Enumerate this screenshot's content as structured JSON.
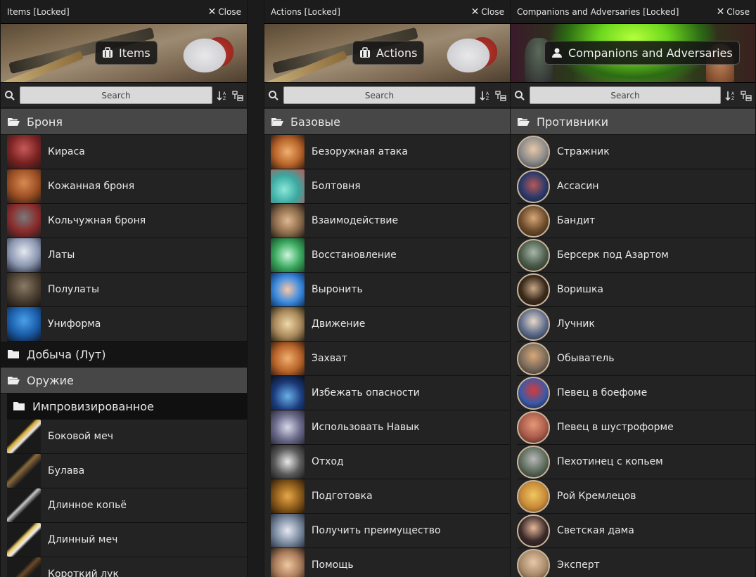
{
  "panels": {
    "items": {
      "title": "Items [Locked]",
      "close_label": "Close",
      "banner_label": "Items",
      "search_placeholder": "Search",
      "folders": [
        {
          "name": "Броня",
          "state": "open",
          "entries": [
            "Кираса",
            "Кожанная броня",
            "Кольчужная броня",
            "Латы",
            "Полулаты",
            "Униформа"
          ]
        },
        {
          "name": "Добыча (Лут)",
          "state": "closed",
          "entries": []
        },
        {
          "name": "Оружие",
          "state": "open",
          "entries": []
        }
      ],
      "subfolder": {
        "name": "Импровизированное",
        "state": "closed"
      },
      "weapon_entries": [
        "Боковой меч",
        "Булава",
        "Длинное копьё",
        "Длинный меч",
        "Короткий лук"
      ]
    },
    "actions": {
      "title": "Actions [Locked]",
      "close_label": "Close",
      "banner_label": "Actions",
      "search_placeholder": "Search",
      "folder": {
        "name": "Базовые",
        "state": "open"
      },
      "entries": [
        "Безоружная атака",
        "Болтовня",
        "Взаимодействие",
        "Восстановление",
        "Выронить",
        "Движение",
        "Захват",
        "Избежать опасности",
        "Использовать Навык",
        "Отход",
        "Подготовка",
        "Получить преимущество",
        "Помощь"
      ]
    },
    "companions": {
      "title": "Companions and Adversaries [Locked]",
      "close_label": "Close",
      "banner_label": "Companions and Adversaries",
      "search_placeholder": "Search",
      "folder": {
        "name": "Противники",
        "state": "open"
      },
      "entries": [
        "Стражник",
        "Ассасин",
        "Бандит",
        "Берсерк под Азартом",
        "Воришка",
        "Лучник",
        "Обыватель",
        "Певец в боефоме",
        "Певец в шустроформе",
        "Пехотинец с копьем",
        "Рой Кремлецов",
        "Светская дама",
        "Эксперт"
      ]
    }
  },
  "icons": {
    "search": "search-icon",
    "sort": "sort-icon",
    "collapse": "collapse-folders-icon",
    "folder_open": "folder-open-icon",
    "folder_closed": "folder-icon",
    "close": "close-icon",
    "items": "briefcase-icon",
    "actions": "briefcase-icon",
    "companions": "user-icon"
  },
  "colors": {
    "panel_bg": "#242424",
    "folder_open_bg": "#474747",
    "folder_closed_bg": "#141414",
    "search_bg": "#d9d9d9",
    "portrait_border": "#c9b49a"
  }
}
